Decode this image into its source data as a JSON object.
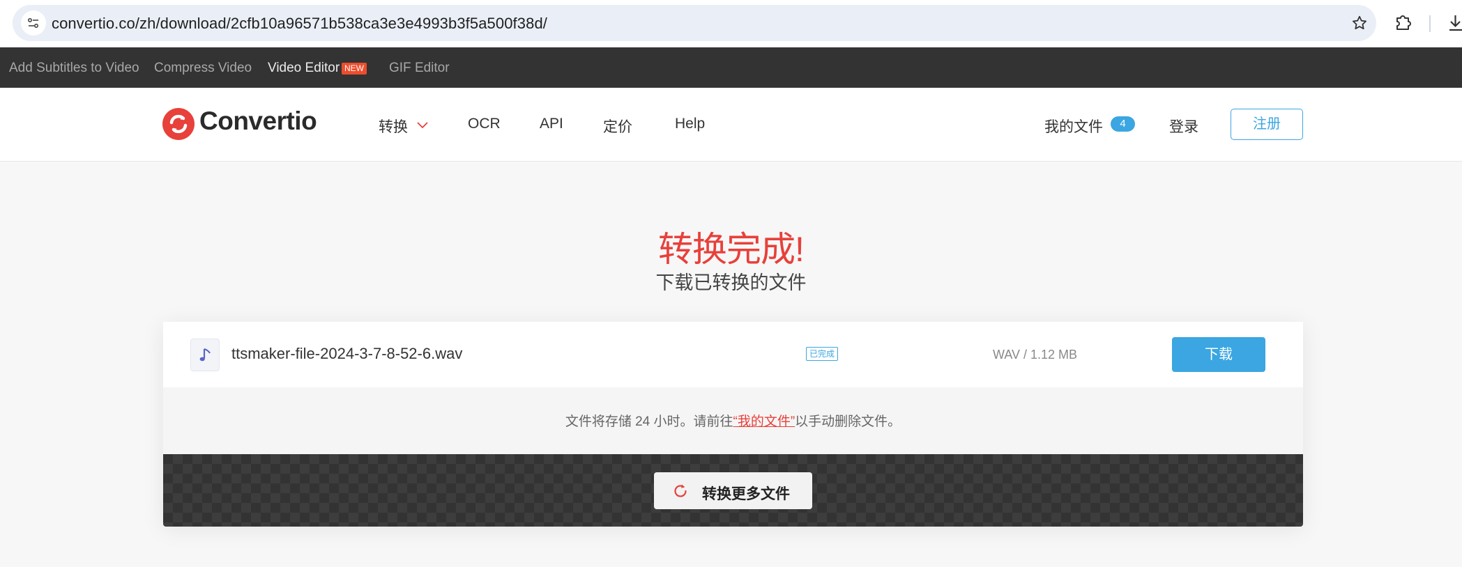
{
  "browser": {
    "url": "convertio.co/zh/download/2cfb10a96571b538ca3e3e4993b3f5a500f38d/",
    "icons": [
      "site-settings-icon",
      "bookmark-star-icon",
      "extensions-icon",
      "download-icon"
    ]
  },
  "toolbar": {
    "links": [
      {
        "label": "Add Subtitles to Video"
      },
      {
        "label": "Compress Video"
      },
      {
        "label": "Video Editor"
      },
      {
        "label": "GIF Editor"
      }
    ],
    "new_badge": "NEW"
  },
  "header": {
    "logo_text": "Convertio",
    "nav": {
      "convert": "转换",
      "ocr": "OCR",
      "api": "API",
      "pricing": "定价",
      "help": "Help"
    },
    "my_files": "我的文件",
    "my_files_count": "4",
    "login": "登录",
    "signup": "注册"
  },
  "hero": {
    "title": "转换完成!",
    "subtitle": "下载已转换的文件"
  },
  "file": {
    "name": "ttsmaker-file-2024-3-7-8-52-6.wav",
    "status": "已完成",
    "meta": "WAV / 1.12 MB",
    "download_label": "下载",
    "icon": "music-note-icon"
  },
  "notice": {
    "before": "文件将存储 24 小时。请前往",
    "link": "“我的文件”",
    "after": "以手动删除文件。"
  },
  "convert_more": {
    "label": "转换更多文件",
    "icon": "refresh-icon"
  },
  "colors": {
    "accent_blue": "#3ba6e1",
    "brand_red": "#e8403a",
    "toolbar_bg": "#333333"
  }
}
